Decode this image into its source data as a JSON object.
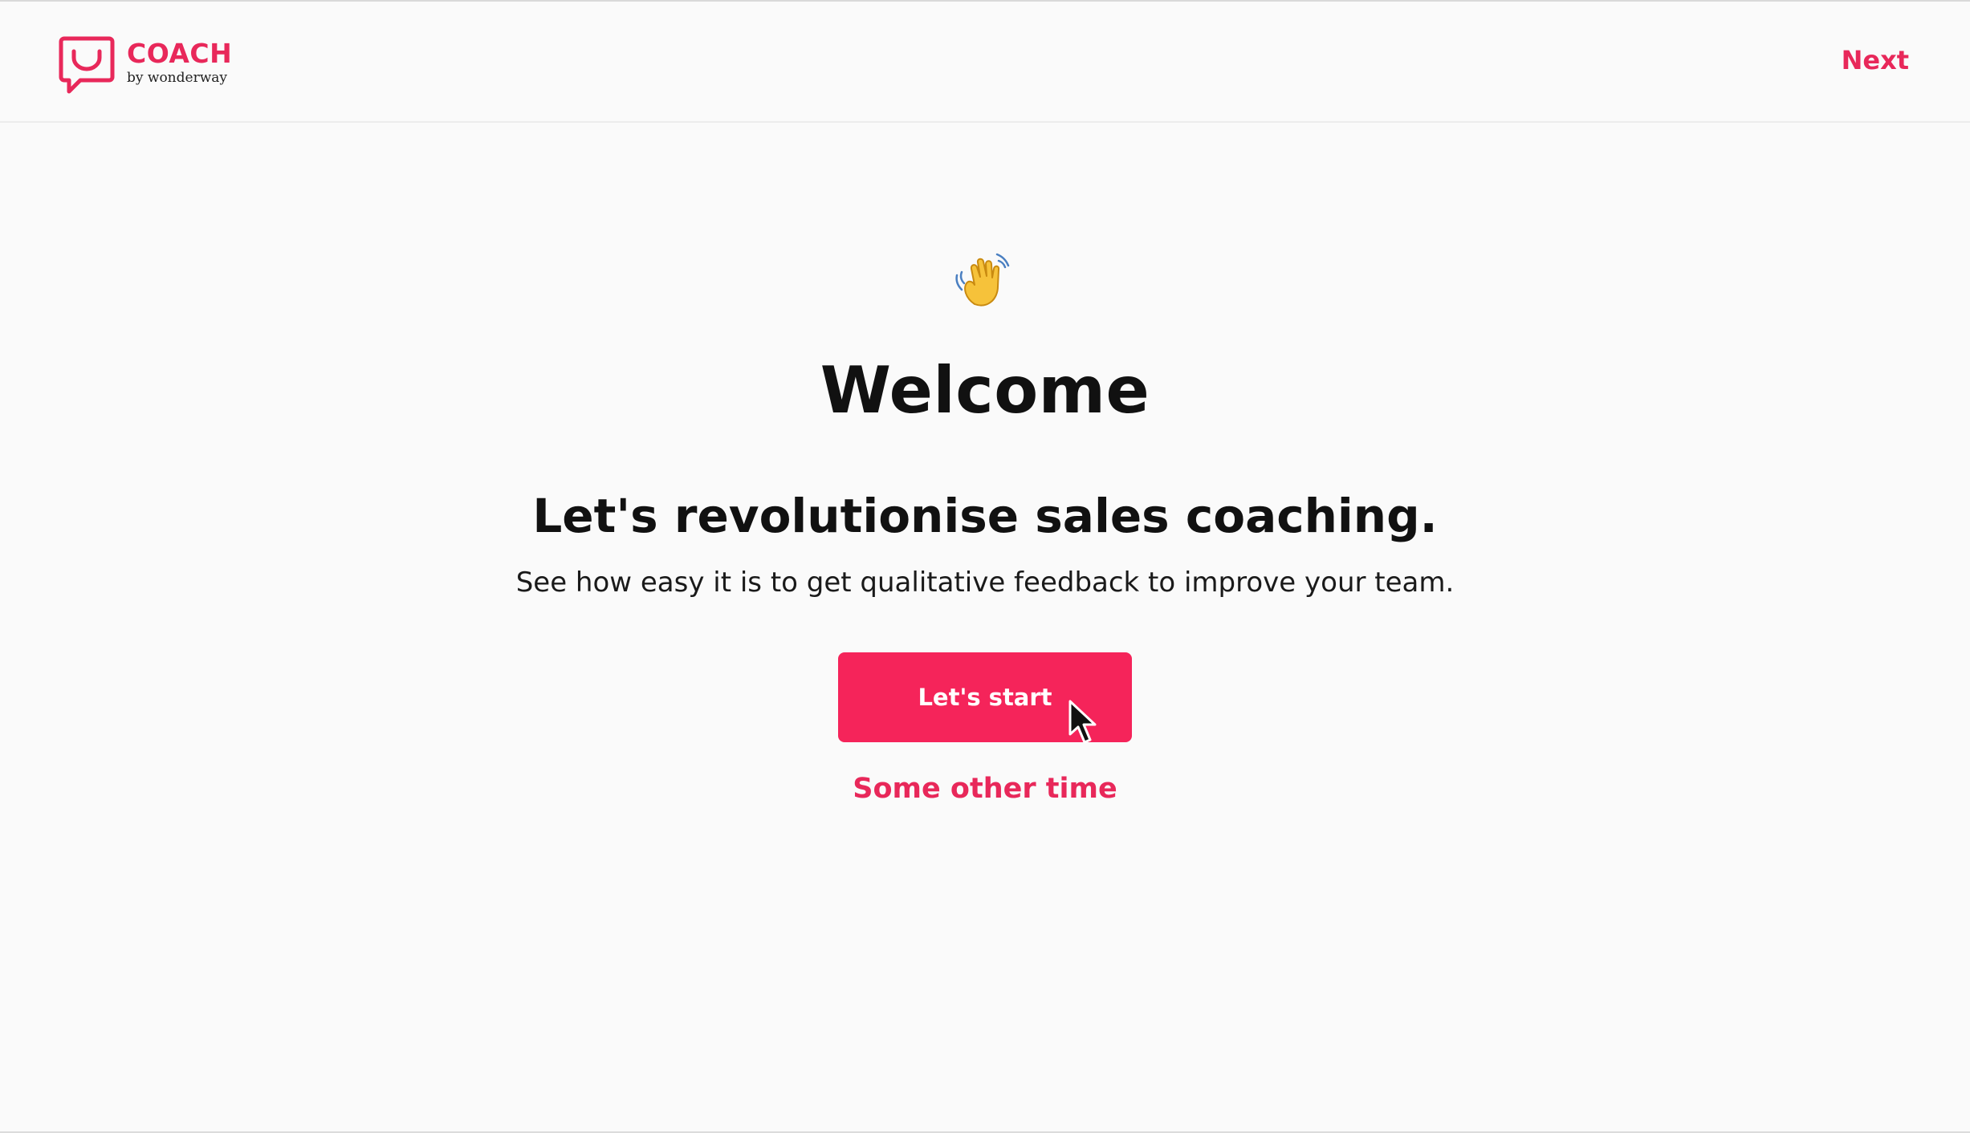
{
  "header": {
    "logo_name": "COACH",
    "logo_tagline": "by wonderway",
    "next_label": "Next"
  },
  "hero": {
    "emoji": "waving-hand-icon",
    "title": "Welcome",
    "tagline": "Let's revolutionise sales coaching.",
    "subtitle": "See how easy it is to get qualitative feedback to improve your team.",
    "primary_button_label": "Let's start",
    "secondary_link_label": "Some other time"
  },
  "colors": {
    "brand": "#e8285a",
    "button": "#f5245a",
    "background": "#fafafa",
    "text": "#111111"
  }
}
